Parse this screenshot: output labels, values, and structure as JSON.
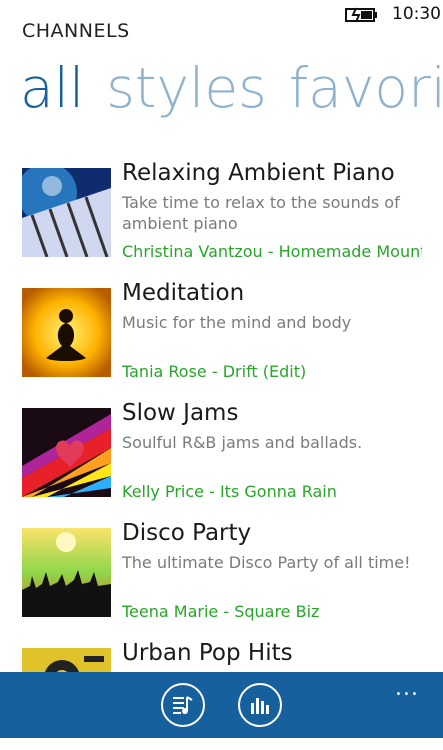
{
  "status": {
    "time": "10:30",
    "battery_icon": "battery-charging-icon"
  },
  "app": {
    "title": "CHANNELS"
  },
  "pivot": {
    "tabs": [
      "all",
      "styles",
      "favori"
    ],
    "active": "all"
  },
  "channels": [
    {
      "title": "Relaxing Ambient Piano",
      "desc": "Take time to relax to the sounds of ambient piano",
      "artist": "Christina Vantzou - Homemade Mounta",
      "thumb": "piano-keys-image"
    },
    {
      "title": "Meditation",
      "desc": "Music for the mind and body",
      "artist": "Tania Rose - Drift (Edit)",
      "thumb": "meditation-silhouette-image"
    },
    {
      "title": "Slow Jams",
      "desc": "Soulful R&B jams and ballads.",
      "artist": "Kelly Price - Its Gonna Rain",
      "thumb": "hearts-rainbow-image"
    },
    {
      "title": "Disco Party",
      "desc": "The ultimate Disco Party of all time!",
      "artist": "Teena Marie - Square Biz",
      "thumb": "disco-crowd-image"
    },
    {
      "title": "Urban Pop Hits",
      "desc": "",
      "artist": "",
      "thumb": "urban-pop-image"
    }
  ],
  "appbar": {
    "buttons": [
      "now-playing-icon",
      "equalizer-icon"
    ],
    "more_label": "..."
  },
  "colors": {
    "accent": "#17609e",
    "artist": "#28a628",
    "pivot_inactive": "#8fb2cf"
  }
}
